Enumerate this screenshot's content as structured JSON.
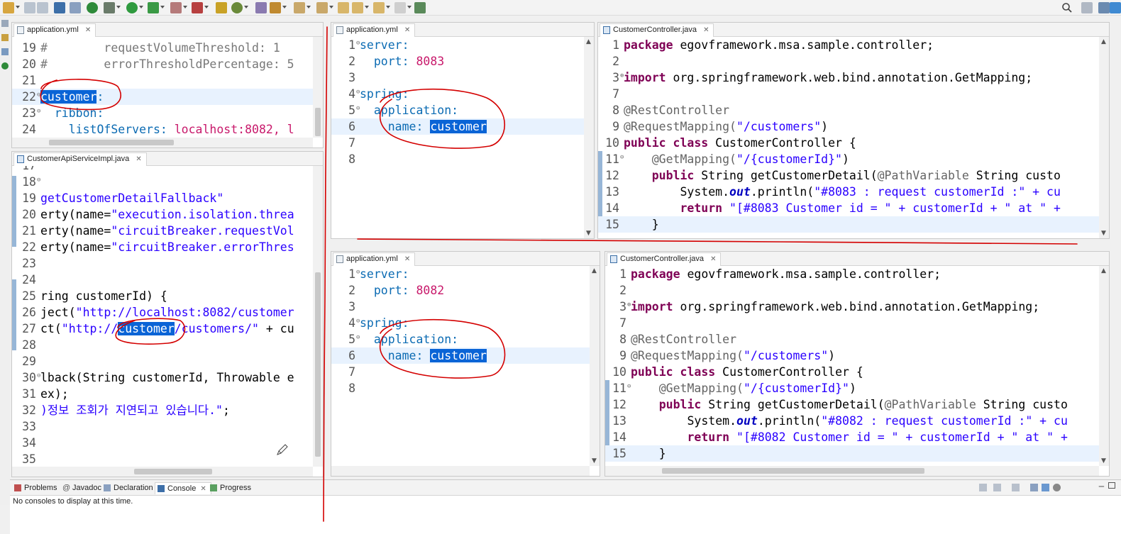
{
  "top_left": {
    "tab_title": "application.yml",
    "lines": [
      {
        "n": "19",
        "fold": "",
        "text": "#        requestVolumeThreshold: 1",
        "cls": "c",
        "hl": false
      },
      {
        "n": "20",
        "fold": "",
        "text": "#        errorThresholdPercentage: 5",
        "cls": "c",
        "hl": false
      },
      {
        "n": "21",
        "fold": "",
        "text": "",
        "cls": "",
        "hl": false
      },
      {
        "n": "22",
        "fold": "⊖",
        "text": "",
        "cls": "",
        "hl": true
      },
      {
        "n": "23",
        "fold": "⊖",
        "text": "  ribbon:",
        "cls": "y",
        "hl": false
      },
      {
        "n": "24",
        "fold": "",
        "text": "    listOfServers: ",
        "cls": "y",
        "hl": false
      }
    ],
    "line22_selected": "customer",
    "line22_suffix": ":",
    "line24_value": "localhost:8082, l"
  },
  "mid_left": {
    "tab_title": "CustomerApiServiceImpl.java",
    "lines": [
      {
        "n": "17",
        "fold": "",
        "parts": [],
        "hl": false
      },
      {
        "n": "18",
        "fold": "⊖",
        "parts": [],
        "hl": false
      },
      {
        "n": "19",
        "fold": "",
        "parts": [
          {
            "t": "getCustomerDetailFallback\"",
            "c": "s"
          }
        ],
        "hl": false
      },
      {
        "n": "20",
        "fold": "",
        "parts": [
          {
            "t": "erty(name=",
            "c": ""
          },
          {
            "t": "\"execution.isolation.threa",
            "c": "s"
          }
        ],
        "hl": false
      },
      {
        "n": "21",
        "fold": "",
        "parts": [
          {
            "t": "erty(name=",
            "c": ""
          },
          {
            "t": "\"circuitBreaker.requestVol",
            "c": "s"
          }
        ],
        "hl": false
      },
      {
        "n": "22",
        "fold": "",
        "parts": [
          {
            "t": "erty(name=",
            "c": ""
          },
          {
            "t": "\"circuitBreaker.errorThres",
            "c": "s"
          }
        ],
        "hl": false
      },
      {
        "n": "23",
        "fold": "",
        "parts": [],
        "hl": false
      },
      {
        "n": "24",
        "fold": "",
        "parts": [],
        "hl": false
      },
      {
        "n": "25",
        "fold": "",
        "parts": [
          {
            "t": "ring customerId) {",
            "c": ""
          }
        ],
        "hl": false
      },
      {
        "n": "26",
        "fold": "",
        "parts": [
          {
            "t": "ject(",
            "c": ""
          },
          {
            "t": "\"http://localhost:8082/customer",
            "c": "s"
          }
        ],
        "hl": false
      },
      {
        "n": "27",
        "fold": "",
        "parts": [
          {
            "t": "ct(",
            "c": ""
          },
          {
            "t": "\"http://",
            "c": "s"
          },
          {
            "t": "customer",
            "c": "sel"
          },
          {
            "t": "/customers/\"",
            "c": "s"
          },
          {
            "t": " + cu",
            "c": ""
          }
        ],
        "hl": false
      },
      {
        "n": "28",
        "fold": "",
        "parts": [],
        "hl": false
      },
      {
        "n": "29",
        "fold": "",
        "parts": [],
        "hl": false
      },
      {
        "n": "30",
        "fold": "⊖",
        "parts": [
          {
            "t": "lback(String customerId, Throwable e",
            "c": ""
          }
        ],
        "hl": false
      },
      {
        "n": "31",
        "fold": "",
        "parts": [
          {
            "t": "ex);",
            "c": ""
          }
        ],
        "hl": false
      },
      {
        "n": "32",
        "fold": "",
        "parts": [
          {
            "t": ")정보 조회가 지연되고 있습니다.\"",
            "c": "s"
          },
          {
            "t": ";",
            "c": ""
          }
        ],
        "hl": false
      },
      {
        "n": "33",
        "fold": "",
        "parts": [],
        "hl": false
      },
      {
        "n": "34",
        "fold": "",
        "parts": [],
        "hl": false
      },
      {
        "n": "35",
        "fold": "",
        "parts": [],
        "hl": false
      }
    ]
  },
  "yml_8083": {
    "tab_title": "application.yml",
    "port": "8083",
    "app_name": "customer"
  },
  "yml_8082": {
    "tab_title": "application.yml",
    "port": "8082",
    "app_name": "customer"
  },
  "yml_common": {
    "server_key": "server:",
    "port_key": "  port: ",
    "spring_key": "spring:",
    "application_key": "  application:",
    "name_key": "    name: "
  },
  "java_8083": {
    "tab_title": "CustomerController.java",
    "println": "\"#8083 : request customerId :\" + cu",
    "ret": "\"[#8083 Customer id = \" + customerId + \" at \" + "
  },
  "java_8082": {
    "tab_title": "CustomerController.java",
    "println": "\"#8082 : request customerId :\" + cu",
    "ret": "\"[#8082 Customer id = \" + customerId + \" at \" + "
  },
  "java_common": {
    "package_kw": "package",
    "package_name": " egovframework.msa.sample.controller;",
    "import_kw": "import",
    "import_name": " org.springframework.web.bind.annotation.GetMapping;",
    "rest_controller": "@RestController",
    "request_mapping": "@RequestMapping(",
    "request_mapping_path": "\"/customers\"",
    "request_mapping_close": ")",
    "public_class": "public class",
    "class_name": " CustomerController {",
    "get_mapping": "    @GetMapping(",
    "get_mapping_path": "\"/{customerId}\"",
    "get_mapping_close": ")",
    "method_public": "    public",
    "method_sig": " String getCustomerDetail(",
    "path_variable": "@PathVariable",
    "method_param": " String custo",
    "sysout_pre": "        System.",
    "sysout_out": "out",
    "sysout_post": ".println(",
    "return_kw": "        return",
    "close_brace": "    }"
  },
  "bottom_panel": {
    "tabs": [
      "Problems",
      "Javadoc",
      "Declaration",
      "Console",
      "Progress"
    ],
    "active_tab": "Console",
    "message": "No consoles to display at this time."
  },
  "colors": {
    "keyword": "#7f0055",
    "string": "#2a00ff",
    "yaml_key": "#0b6bb3",
    "yaml_number": "#c8196b",
    "selection": "#0a64d6",
    "annotation_red": "#d40000"
  }
}
